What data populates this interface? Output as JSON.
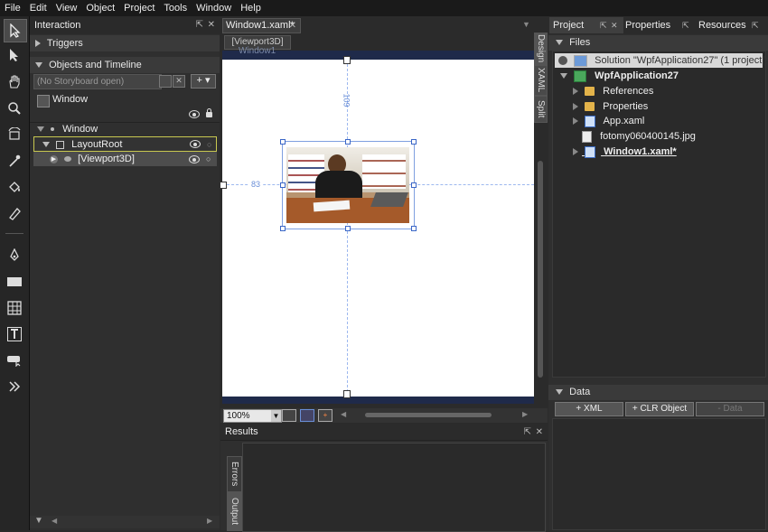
{
  "menu": [
    "File",
    "Edit",
    "View",
    "Object",
    "Project",
    "Tools",
    "Window",
    "Help"
  ],
  "interaction": {
    "title": "Interaction",
    "triggers_label": "Triggers",
    "objects_label": "Objects and Timeline",
    "storyboard_placeholder": "(No Storyboard open)",
    "scope_label": "Window",
    "tree": {
      "window": "Window",
      "layoutroot": "LayoutRoot",
      "viewport": "[Viewport3D]"
    }
  },
  "document": {
    "tab_label": "Window1.xaml*",
    "breadcrumb": "[Viewport3D]",
    "window_label": "Window1",
    "view_tabs": [
      "Design",
      "XAML",
      "Split"
    ],
    "measure_top": "109",
    "measure_left": "83",
    "zoom": "100%"
  },
  "results": {
    "title": "Results",
    "tabs": [
      "Errors",
      "Output"
    ]
  },
  "project_panel": {
    "tabs": [
      "Project",
      "Properties",
      "Resources"
    ],
    "files_label": "Files",
    "solution": "Solution \"WpfApplication27\" (1 project(s))",
    "project": "WpfApplication27",
    "items": [
      "References",
      "Properties",
      "App.xaml",
      "fotomy060400145.jpg",
      "Window1.xaml*"
    ]
  },
  "data_panel": {
    "title": "Data",
    "buttons": [
      "+ XML",
      "+ CLR Object",
      "- Data"
    ]
  }
}
